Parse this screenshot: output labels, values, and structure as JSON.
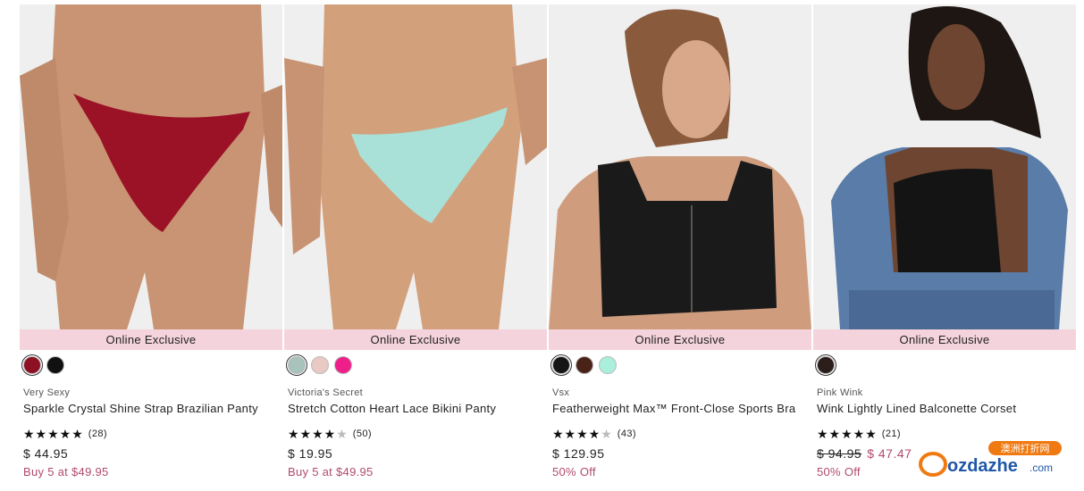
{
  "products": [
    {
      "badge": "Online Exclusive",
      "swatches": [
        "#8e1023",
        "#111111"
      ],
      "brand": "Very Sexy",
      "name": "Sparkle Crystal Shine Strap Brazilian Panty",
      "stars": "★★★★★",
      "stars_dim": "",
      "reviews": "(28)",
      "price": "$ 44.95",
      "was_price": "",
      "promo": "Buy 5 at $49.95",
      "garment_color": "#9b1226"
    },
    {
      "badge": "Online Exclusive",
      "swatches": [
        "#a7c3bc",
        "#e8c9c4",
        "#ef1f8a"
      ],
      "brand": "Victoria's Secret",
      "name": "Stretch Cotton Heart Lace Bikini Panty",
      "stars": "★★★★",
      "stars_dim": "★",
      "reviews": "(50)",
      "price": "$ 19.95",
      "was_price": "",
      "promo": "Buy 5 at $49.95",
      "garment_color": "#a9e0d8"
    },
    {
      "badge": "Online Exclusive",
      "swatches": [
        "#151515",
        "#4a2318",
        "#a9efdc"
      ],
      "brand": "Vsx",
      "name": "Featherweight Max™ Front-Close Sports Bra",
      "stars": "★★★★",
      "stars_dim": "★",
      "reviews": "(43)",
      "price": "$ 129.95",
      "was_price": "",
      "promo": "50% Off",
      "garment_color": "#1a1a1a"
    },
    {
      "badge": "Online Exclusive",
      "swatches": [
        "#2a1d1a"
      ],
      "brand": "Pink Wink",
      "name": "Wink Lightly Lined Balconette Corset",
      "stars": "★★★★★",
      "stars_dim": "",
      "reviews": "(21)",
      "price": "$ 47.47",
      "was_price": "$ 94.95",
      "promo": "50% Off",
      "garment_color": "#141414"
    }
  ],
  "watermark": {
    "text": "ozdazhe",
    "suffix": ".com",
    "tag": "澳洲打折网"
  }
}
